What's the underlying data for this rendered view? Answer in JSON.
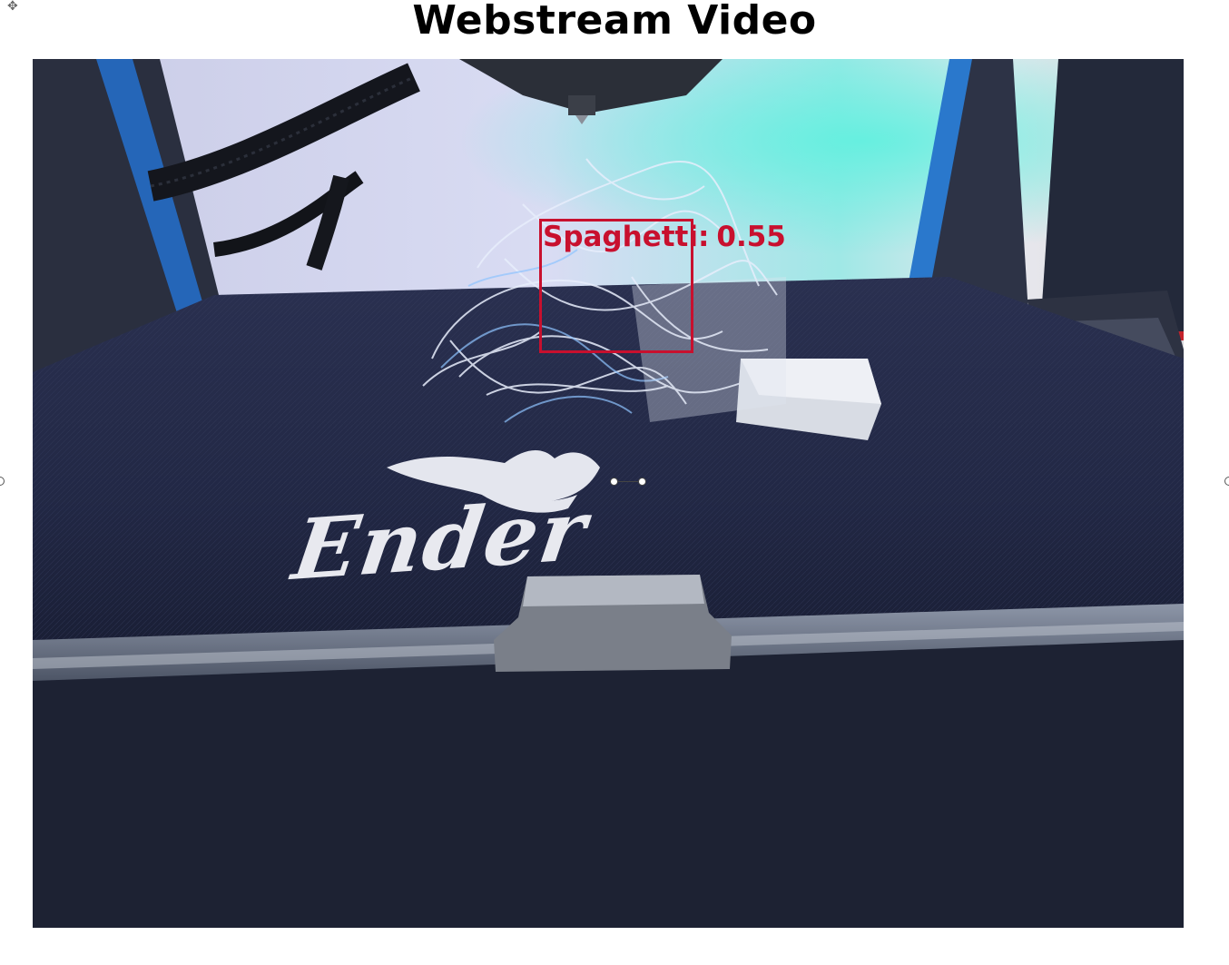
{
  "header": {
    "title": "Webstream Video"
  },
  "video": {
    "bed_brand": "Ender"
  },
  "detection": {
    "label": "Spaghetti:",
    "confidence": "0.55",
    "color": "#c8102e"
  },
  "icons": {
    "move": "move-icon",
    "resize": "resize-handle-icon"
  }
}
